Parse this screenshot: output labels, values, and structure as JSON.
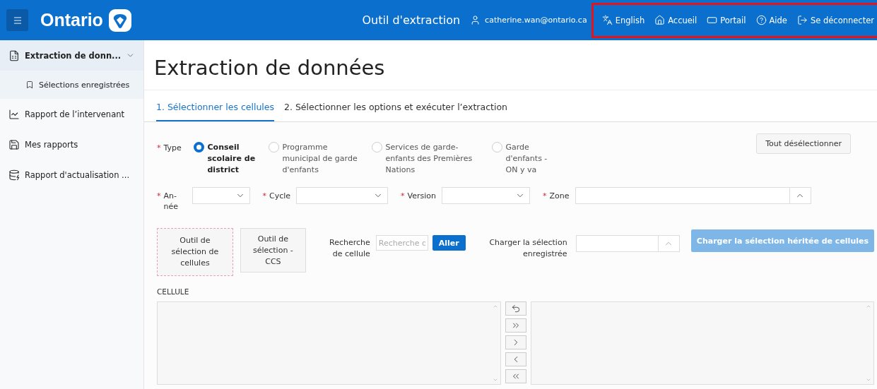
{
  "header": {
    "brand": "Ontario",
    "app_title": "Outil d'extraction",
    "user": "catherine.wan@ontario.ca",
    "highlighted": true,
    "nav": [
      {
        "label": "English"
      },
      {
        "label": "Accueil"
      },
      {
        "label": "Portail"
      },
      {
        "label": "Aide"
      },
      {
        "label": "Se déconnecter"
      }
    ]
  },
  "sidebar": {
    "items": [
      {
        "label": "Extraction de donn...",
        "selected": true,
        "expanded": true,
        "children": [
          {
            "label": "Sélections enregistrées",
            "selected": false
          }
        ]
      },
      {
        "label": "Rapport de l’intervenant",
        "selected": false
      },
      {
        "label": "Mes rapports",
        "selected": false
      },
      {
        "label": "Rapport d'actualisation ...",
        "selected": false
      }
    ]
  },
  "page_title": "Extraction de données",
  "tabs": [
    {
      "label": "1. Sélectionner les cellules",
      "selected": true
    },
    {
      "label": "2. Sélectionner les options et exécuter l’extraction",
      "selected": false
    }
  ],
  "form": {
    "type": {
      "label": "Type",
      "required_mark": "*",
      "options": [
        {
          "label": "Conseil scolaire de district",
          "selected": true
        },
        {
          "label": "Programme municipal de garde d'enfants",
          "selected": false
        },
        {
          "label": "Services de garde-enfants des Premières Nations",
          "selected": false
        },
        {
          "label": "Garde d'enfants - ON y va",
          "selected": false
        }
      ]
    },
    "deselect_button": "Tout désélectionner",
    "selects": [
      {
        "label": "An-née",
        "required_mark": "*",
        "kind": "down"
      },
      {
        "label": "Cycle",
        "required_mark": "*",
        "kind": "down"
      },
      {
        "label": "Version",
        "required_mark": "*",
        "kind": "down"
      },
      {
        "label": "Zone",
        "required_mark": "*",
        "kind": "up"
      }
    ],
    "tool_buttons": [
      {
        "label": "Outil de sélection de cellules",
        "focused": true
      },
      {
        "label": "Outil de sélection - CCS",
        "focused": false
      }
    ],
    "search": {
      "label": "Recherche de cellule",
      "placeholder": "Recherche d"
    },
    "go_button": "Aller",
    "saved": {
      "label": "Charger la sélection enregistrée"
    },
    "inherit_button": "Charger la sélection héritée de cellules",
    "list_label": "CELLULE"
  }
}
